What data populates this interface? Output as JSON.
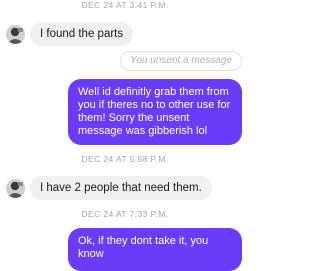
{
  "messages": [
    {
      "kind": "timestamp",
      "text": "DEC 24 AT 3:41 P.M."
    },
    {
      "kind": "received",
      "text": "I found the parts",
      "avatar_icon": "profile-avatar"
    },
    {
      "kind": "unsent",
      "text": "You unsent a message"
    },
    {
      "kind": "sent",
      "text": "Well id definitly grab them from you if theres no to other use for them! Sorry the unsent message was gibberish lol"
    },
    {
      "kind": "timestamp",
      "text": "DEC 24 AT 5:58 P.M."
    },
    {
      "kind": "received",
      "text": "I have 2 people that need them.",
      "avatar_icon": "profile-avatar"
    },
    {
      "kind": "timestamp",
      "text": "DEC 24 AT 7:33 P.M."
    },
    {
      "kind": "sent",
      "text": "Ok, if they dont take it, you know"
    }
  ],
  "colors": {
    "sent_bubble": "#6b3bfa",
    "received_bubble": "#f0f0f0",
    "timestamp_text": "#a6a6a6"
  }
}
